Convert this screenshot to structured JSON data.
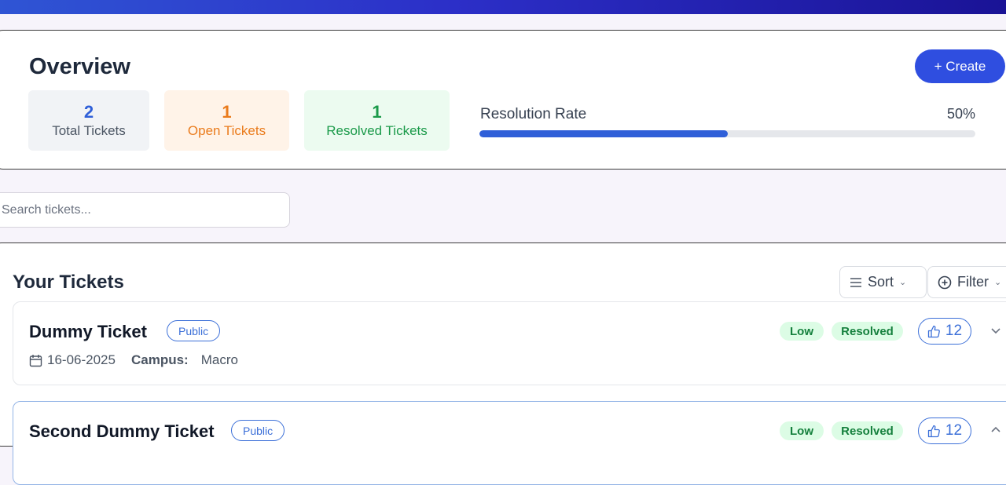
{
  "overview": {
    "title": "Overview",
    "create_label": "+ Create",
    "stats": {
      "total": {
        "value": "2",
        "label": "Total Tickets"
      },
      "open": {
        "value": "1",
        "label": "Open Tickets"
      },
      "resolved": {
        "value": "1",
        "label": "Resolved Tickets"
      }
    },
    "resolution": {
      "label": "Resolution Rate",
      "value_text": "50%",
      "fraction": 0.5
    }
  },
  "search": {
    "placeholder": "Search tickets..."
  },
  "tickets": {
    "title": "Your Tickets",
    "sort_label": "Sort",
    "filter_label": "Filter",
    "items": [
      {
        "name": "Dummy Ticket",
        "visibility": "Public",
        "date": "16-06-2025",
        "campus_key": "Campus:",
        "campus": "Macro",
        "priority": "Low",
        "status": "Resolved",
        "likes": "12"
      },
      {
        "name": "Second Dummy Ticket",
        "visibility": "Public",
        "priority": "Low",
        "status": "Resolved",
        "likes": "12"
      }
    ]
  },
  "colors": {
    "accent": "#2f4ee0",
    "progress": "#2f5fd8",
    "open": "#ea7b1c",
    "resolved": "#1b9a4a"
  },
  "icons": [
    "plus-icon",
    "menu-lines-icon",
    "chevron-down-icon",
    "plus-circle-icon",
    "calendar-icon",
    "thumbs-up-icon"
  ]
}
